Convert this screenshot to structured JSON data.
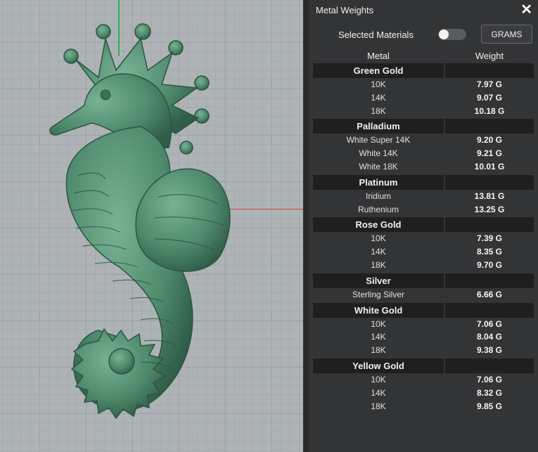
{
  "panel": {
    "title": "Metal Weights",
    "close_icon": "close-icon",
    "selected_materials_label": "Selected Materials",
    "toggle_on": false,
    "units_button": "GRAMS",
    "col_metal": "Metal",
    "col_weight": "Weight"
  },
  "colors": {
    "model": "#4f8a6c",
    "panel_bg": "#333436",
    "group_bg": "#1f1f20"
  },
  "groups": [
    {
      "name": "Green Gold",
      "items": [
        {
          "metal": "10K",
          "weight": "7.97 G"
        },
        {
          "metal": "14K",
          "weight": "9.07 G"
        },
        {
          "metal": "18K",
          "weight": "10.18 G"
        }
      ]
    },
    {
      "name": "Palladium",
      "items": [
        {
          "metal": "White Super 14K",
          "weight": "9.20 G"
        },
        {
          "metal": "White 14K",
          "weight": "9.21 G"
        },
        {
          "metal": "White 18K",
          "weight": "10.01 G"
        }
      ]
    },
    {
      "name": "Platinum",
      "items": [
        {
          "metal": "Iridium",
          "weight": "13.81 G"
        },
        {
          "metal": "Ruthenium",
          "weight": "13.25 G"
        }
      ]
    },
    {
      "name": "Rose Gold",
      "items": [
        {
          "metal": "10K",
          "weight": "7.39 G"
        },
        {
          "metal": "14K",
          "weight": "8.35 G"
        },
        {
          "metal": "18K",
          "weight": "9.70 G"
        }
      ]
    },
    {
      "name": "Silver",
      "items": [
        {
          "metal": "Sterling Silver",
          "weight": "6.66 G"
        }
      ]
    },
    {
      "name": "White Gold",
      "items": [
        {
          "metal": "10K",
          "weight": "7.06 G"
        },
        {
          "metal": "14K",
          "weight": "8.04 G"
        },
        {
          "metal": "18K",
          "weight": "9.38 G"
        }
      ]
    },
    {
      "name": "Yellow Gold",
      "items": [
        {
          "metal": "10K",
          "weight": "7.06 G"
        },
        {
          "metal": "14K",
          "weight": "8.32 G"
        },
        {
          "metal": "18K",
          "weight": "9.85 G"
        }
      ]
    }
  ]
}
